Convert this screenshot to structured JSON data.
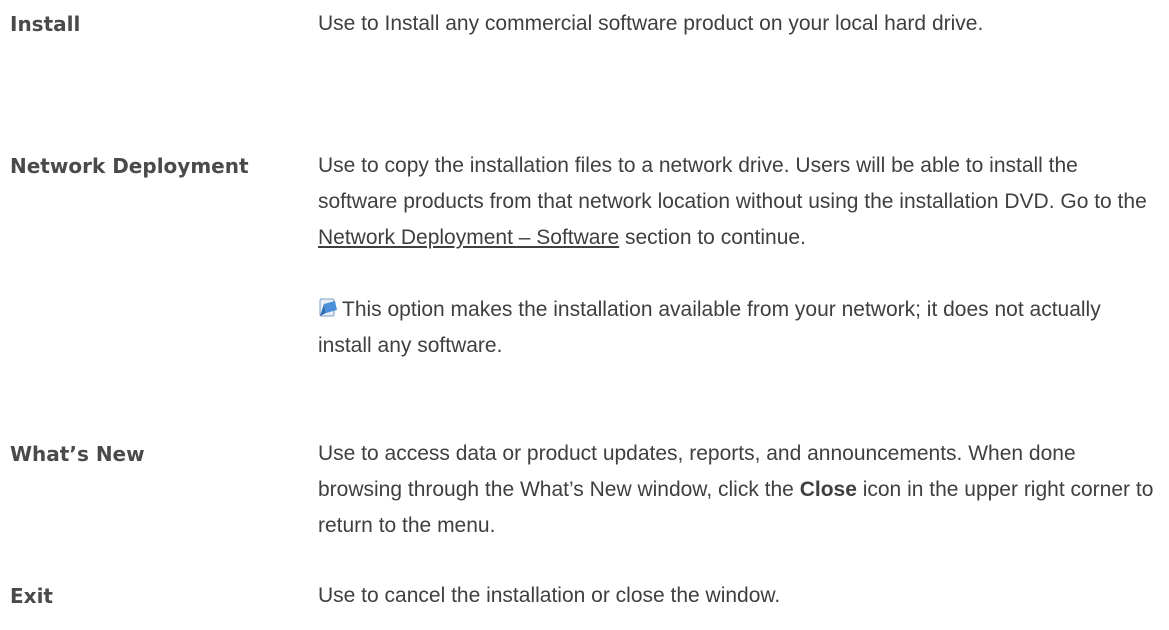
{
  "entries": [
    {
      "term": "Install",
      "description": "Use to Install any commercial software product on your local hard drive."
    },
    {
      "term": "Network Deployment",
      "description_before_link": "Use to copy the installation files to a network drive. Users will be able to install the software products from that network location without using the installation DVD. Go to the ",
      "link_text": "Network Deployment – Software",
      "description_after_link": " section to continue.",
      "note_icon": "note-icon",
      "note_text": "This option makes the installation available from your network; it does not actually install any software."
    },
    {
      "term": "What’s New",
      "description_before_bold": "Use to access data or product updates, reports, and announcements. When done browsing through the What’s New window, click the ",
      "bold_text": "Close",
      "description_after_bold": " icon in the upper right corner to return to the menu."
    },
    {
      "term": "Exit",
      "description": "Use to cancel the installation or close the window."
    }
  ],
  "colors": {
    "text": "#3f3f3f",
    "note_icon_blue": "#4a90d9",
    "note_icon_paper": "#e8eef6"
  }
}
